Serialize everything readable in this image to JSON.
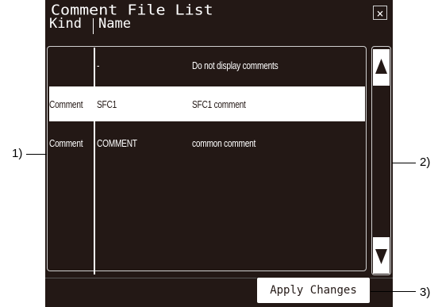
{
  "dialog": {
    "title": "Comment File List",
    "close_glyph": "×",
    "columns": {
      "kind": "Kind",
      "name": "Name"
    }
  },
  "list": {
    "rows": [
      {
        "kind": "",
        "file": "-",
        "description": "Do not display comments",
        "selected": false
      },
      {
        "kind": "Comment",
        "file": "SFC1",
        "description": "SFC1 comment",
        "selected": true
      },
      {
        "kind": "Comment",
        "file": "COMMENT",
        "description": "common comment",
        "selected": false
      }
    ]
  },
  "scrollbar": {
    "up_icon": "triangle-up",
    "down_icon": "triangle-down"
  },
  "actions": {
    "apply_label": "Apply Changes"
  },
  "callouts": {
    "list_area": "1)",
    "scrollbar": "2)",
    "apply_button": "3)"
  },
  "colors": {
    "panel_bg": "#231815",
    "selected_row_bg": "#ffffff",
    "text": "#ffffff"
  }
}
